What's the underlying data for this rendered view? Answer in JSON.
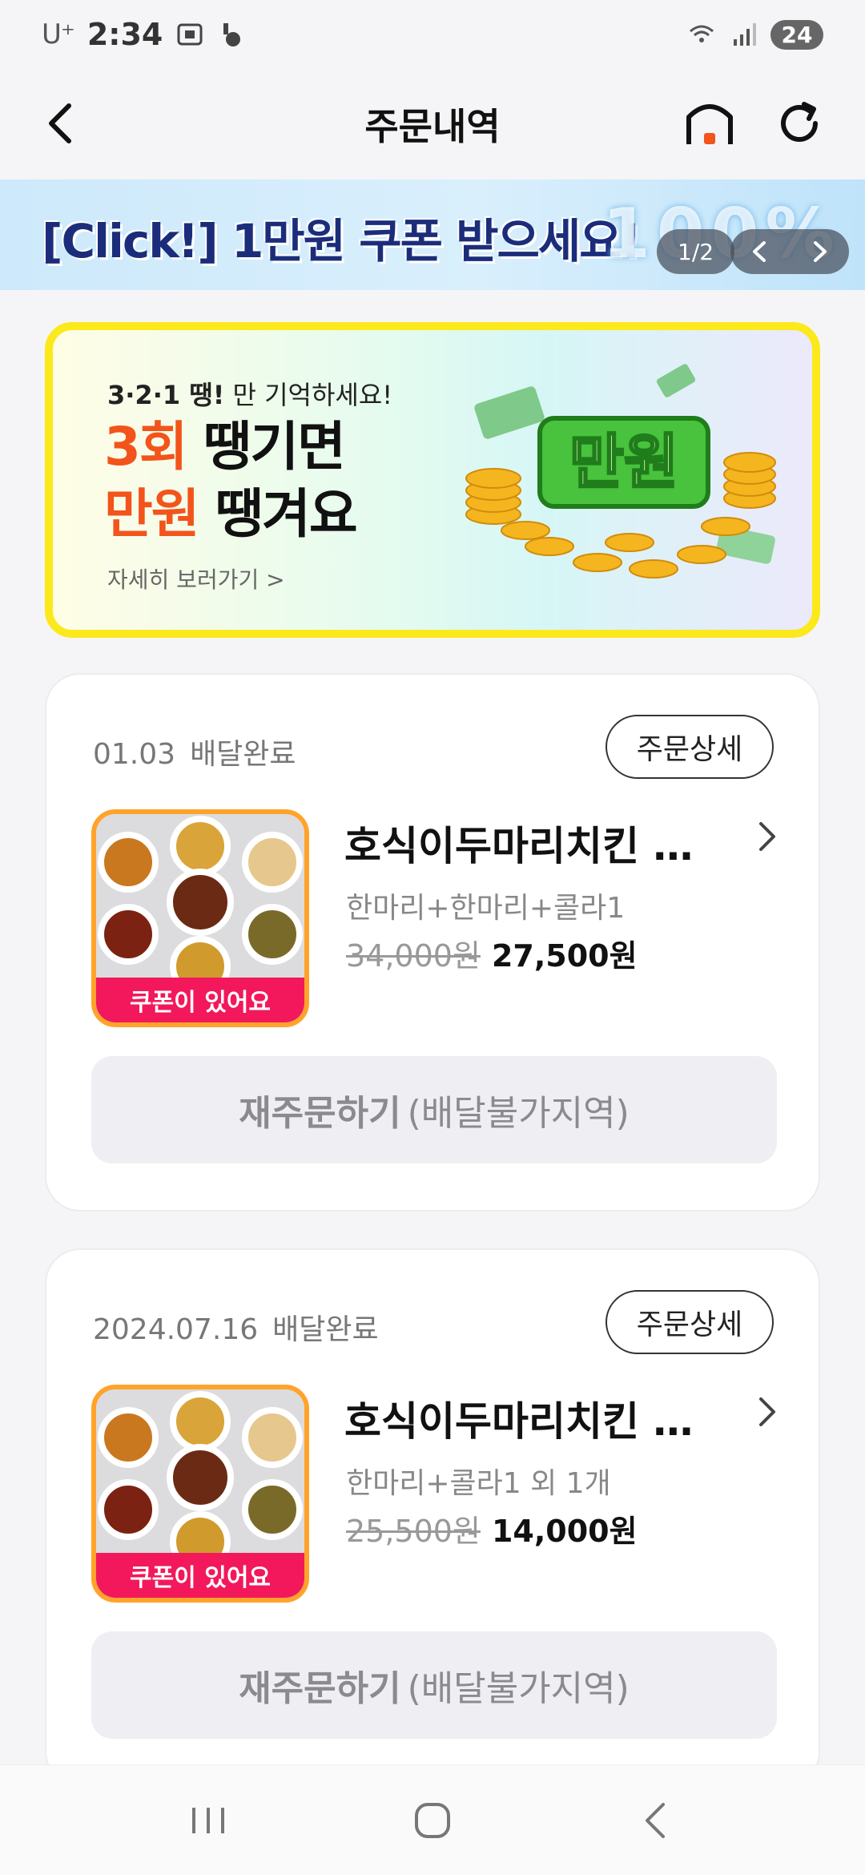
{
  "status_bar": {
    "carrier": "U⁺",
    "time": "2:34",
    "battery": "24"
  },
  "app_bar": {
    "title": "주문내역"
  },
  "promo_banner": {
    "text": "[Click!] 1만원 쿠폰 받으세요!",
    "art_text": "100%",
    "pager": "1/2"
  },
  "event": {
    "kicker_bold": "3·2·1 땡!",
    "kicker_rest": " 만 기억하세요!",
    "line1_accent": "3회",
    "line1_rest": " 땡기면",
    "line2_accent": "만원",
    "line2_rest": " 땡겨요",
    "link": "자세히 보러가기 >",
    "art_label": "만원"
  },
  "orders": [
    {
      "date": "01.03",
      "status": "배달완료",
      "detail_label": "주문상세",
      "coupon_tag": "쿠폰이 있어요",
      "store": "호식이두마리치킨 옥…",
      "menu": "한마리+한마리+콜라1",
      "price_original": "34,000원",
      "price_final": "27,500원",
      "reorder_strong": "재주문하기",
      "reorder_note": "(배달불가지역)"
    },
    {
      "date": "2024.07.16",
      "status": "배달완료",
      "detail_label": "주문상세",
      "coupon_tag": "쿠폰이 있어요",
      "store": "호식이두마리치킨 옥…",
      "menu": "한마리+콜라1 외 1개",
      "price_original": "25,500원",
      "price_final": "14,000원",
      "reorder_strong": "재주문하기",
      "reorder_note": "(배달불가지역)"
    }
  ],
  "colors": {
    "accent_orange": "#f2541b",
    "coupon_pink": "#f2185b",
    "event_border": "#fbe91c",
    "banner_text": "#1b2d7a"
  },
  "icons": [
    "back-arrow-icon",
    "home-icon",
    "refresh-icon",
    "chevron-left-icon",
    "chevron-right-icon",
    "recent-apps-icon",
    "home-circle-icon",
    "system-back-icon"
  ]
}
